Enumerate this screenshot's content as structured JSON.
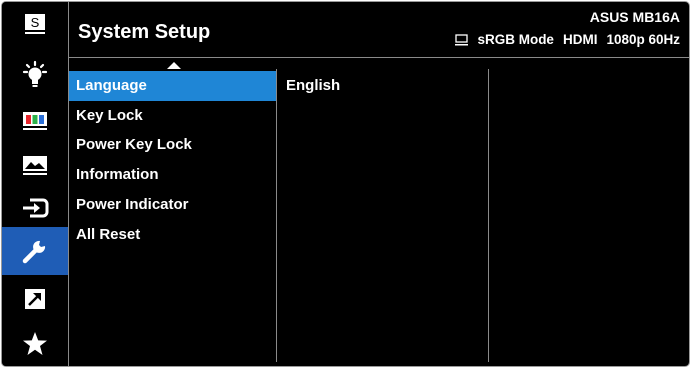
{
  "header": {
    "title": "System Setup",
    "model": "ASUS MB16A",
    "status": {
      "mode": "sRGB Mode",
      "input": "HDMI",
      "resolution": "1080p 60Hz"
    }
  },
  "sidebar": {
    "active_index": 5,
    "items": [
      {
        "icon": "splendid-icon",
        "glyph": "S"
      },
      {
        "icon": "blue-light-filter-icon"
      },
      {
        "icon": "color-icon"
      },
      {
        "icon": "image-icon"
      },
      {
        "icon": "input-select-icon"
      },
      {
        "icon": "system-setup-icon"
      },
      {
        "icon": "shortcut-icon"
      },
      {
        "icon": "my-favorite-icon"
      }
    ]
  },
  "menu": {
    "items": [
      {
        "label": "Language",
        "selected": true
      },
      {
        "label": "Key Lock"
      },
      {
        "label": "Power Key Lock"
      },
      {
        "label": "Information"
      },
      {
        "label": "Power Indicator"
      },
      {
        "label": "All Reset"
      }
    ]
  },
  "submenu": {
    "value": "English"
  },
  "colors": {
    "background": "#000000",
    "sidebar_active": "#1f5db6",
    "menu_highlight": "#1f86d6",
    "text": "#ffffff",
    "divider": "#8a8a8a"
  }
}
